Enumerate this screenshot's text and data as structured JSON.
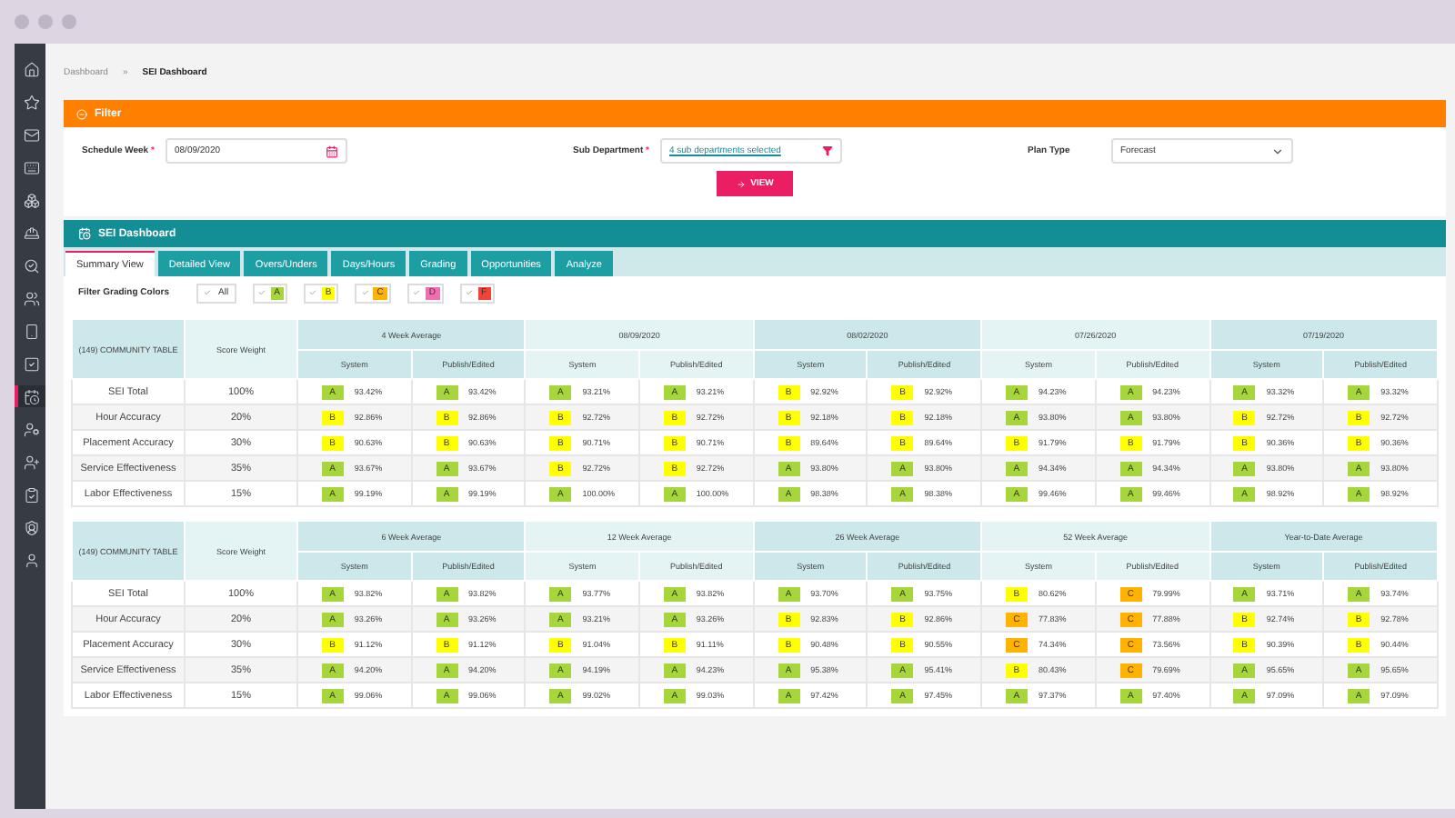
{
  "sidebar": {
    "items": [
      {
        "selected": false
      },
      {
        "selected": false
      },
      {
        "selected": false
      },
      {
        "selected": false
      },
      {
        "selected": false
      },
      {
        "selected": false
      },
      {
        "selected": false
      },
      {
        "selected": false
      },
      {
        "selected": false
      },
      {
        "selected": false
      },
      {
        "selected": true
      },
      {
        "selected": false
      },
      {
        "selected": false
      },
      {
        "selected": false
      },
      {
        "selected": false
      },
      {
        "selected": false
      }
    ]
  },
  "breadcrumb": {
    "items": [
      "Dashboard",
      "SEI Dashboard"
    ],
    "separator": "»"
  },
  "filter": {
    "title": "Filter",
    "schedule_week": {
      "label": "Schedule Week",
      "required_mark": "*",
      "value": "08/09/2020"
    },
    "sub_department": {
      "label": "Sub Department",
      "required_mark": "*",
      "value": "4 sub departments selected"
    },
    "plan_type": {
      "label": "Plan Type",
      "value": "Forecast"
    },
    "button": "VIEW"
  },
  "dashboard": {
    "title": "SEI Dashboard",
    "tabs": [
      {
        "label": "Summary View",
        "selected": true
      },
      {
        "label": "Detailed View",
        "selected": false
      },
      {
        "label": "Overs/Unders",
        "selected": false
      },
      {
        "label": "Days/Hours",
        "selected": false
      },
      {
        "label": "Grading",
        "selected": false
      },
      {
        "label": "Opportunities",
        "selected": false
      },
      {
        "label": "Analyze",
        "selected": false
      }
    ],
    "grading_filter": {
      "label": "Filter Grading Colors",
      "options": [
        {
          "label": "All",
          "checked": true
        },
        {
          "label": "A",
          "checked": true,
          "color": "#a6d53c"
        },
        {
          "label": "B",
          "checked": true,
          "color": "#ffff00"
        },
        {
          "label": "C",
          "checked": true,
          "color": "#ffb300"
        },
        {
          "label": "D",
          "checked": true,
          "color": "#f06fb0"
        },
        {
          "label": "F",
          "checked": true,
          "color": "#f44336"
        }
      ]
    },
    "tables": [
      {
        "title": "(149) COMMUNITY TABLE",
        "weight_header": "Score Weight",
        "groups": [
          {
            "title": "4 Week Average",
            "subheaders": [
              "System",
              "Publish/Edited"
            ]
          },
          {
            "title": "08/09/2020",
            "subheaders": [
              "System",
              "Publish/Edited"
            ]
          },
          {
            "title": "08/02/2020",
            "subheaders": [
              "System",
              "Publish/Edited"
            ]
          },
          {
            "title": "07/26/2020",
            "subheaders": [
              "System",
              "Publish/Edited"
            ]
          },
          {
            "title": "07/19/2020",
            "subheaders": [
              "System",
              "Publish/Edited"
            ]
          }
        ],
        "rows": [
          {
            "name": "SEI Total",
            "weight": "100%",
            "cells": [
              {
                "grade": "A",
                "value": "93.42%",
                "color": "#a6d53c"
              },
              {
                "grade": "A",
                "value": "93.42%",
                "color": "#a6d53c"
              },
              {
                "grade": "A",
                "value": "93.21%",
                "color": "#a6d53c"
              },
              {
                "grade": "A",
                "value": "93.21%",
                "color": "#a6d53c"
              },
              {
                "grade": "B",
                "value": "92.92%",
                "color": "#ffff00"
              },
              {
                "grade": "B",
                "value": "92.92%",
                "color": "#ffff00"
              },
              {
                "grade": "A",
                "value": "94.23%",
                "color": "#a6d53c"
              },
              {
                "grade": "A",
                "value": "94.23%",
                "color": "#a6d53c"
              },
              {
                "grade": "A",
                "value": "93.32%",
                "color": "#a6d53c"
              },
              {
                "grade": "A",
                "value": "93.32%",
                "color": "#a6d53c"
              }
            ]
          },
          {
            "name": "Hour Accuracy",
            "weight": "20%",
            "cells": [
              {
                "grade": "B",
                "value": "92.86%",
                "color": "#ffff00"
              },
              {
                "grade": "B",
                "value": "92.86%",
                "color": "#ffff00"
              },
              {
                "grade": "B",
                "value": "92.72%",
                "color": "#ffff00"
              },
              {
                "grade": "B",
                "value": "92.72%",
                "color": "#ffff00"
              },
              {
                "grade": "B",
                "value": "92.18%",
                "color": "#ffff00"
              },
              {
                "grade": "B",
                "value": "92.18%",
                "color": "#ffff00"
              },
              {
                "grade": "A",
                "value": "93.80%",
                "color": "#a6d53c"
              },
              {
                "grade": "A",
                "value": "93.80%",
                "color": "#a6d53c"
              },
              {
                "grade": "B",
                "value": "92.72%",
                "color": "#ffff00"
              },
              {
                "grade": "B",
                "value": "92.72%",
                "color": "#ffff00"
              }
            ]
          },
          {
            "name": "Placement Accuracy",
            "weight": "30%",
            "cells": [
              {
                "grade": "B",
                "value": "90.63%",
                "color": "#ffff00"
              },
              {
                "grade": "B",
                "value": "90.63%",
                "color": "#ffff00"
              },
              {
                "grade": "B",
                "value": "90.71%",
                "color": "#ffff00"
              },
              {
                "grade": "B",
                "value": "90.71%",
                "color": "#ffff00"
              },
              {
                "grade": "B",
                "value": "89.64%",
                "color": "#ffff00"
              },
              {
                "grade": "B",
                "value": "89.64%",
                "color": "#ffff00"
              },
              {
                "grade": "B",
                "value": "91.79%",
                "color": "#ffff00"
              },
              {
                "grade": "B",
                "value": "91.79%",
                "color": "#ffff00"
              },
              {
                "grade": "B",
                "value": "90.36%",
                "color": "#ffff00"
              },
              {
                "grade": "B",
                "value": "90.36%",
                "color": "#ffff00"
              }
            ]
          },
          {
            "name": "Service Effectiveness",
            "weight": "35%",
            "cells": [
              {
                "grade": "A",
                "value": "93.67%",
                "color": "#a6d53c"
              },
              {
                "grade": "A",
                "value": "93.67%",
                "color": "#a6d53c"
              },
              {
                "grade": "B",
                "value": "92.72%",
                "color": "#ffff00"
              },
              {
                "grade": "B",
                "value": "92.72%",
                "color": "#ffff00"
              },
              {
                "grade": "A",
                "value": "93.80%",
                "color": "#a6d53c"
              },
              {
                "grade": "A",
                "value": "93.80%",
                "color": "#a6d53c"
              },
              {
                "grade": "A",
                "value": "94.34%",
                "color": "#a6d53c"
              },
              {
                "grade": "A",
                "value": "94.34%",
                "color": "#a6d53c"
              },
              {
                "grade": "A",
                "value": "93.80%",
                "color": "#a6d53c"
              },
              {
                "grade": "A",
                "value": "93.80%",
                "color": "#a6d53c"
              }
            ]
          },
          {
            "name": "Labor Effectiveness",
            "weight": "15%",
            "cells": [
              {
                "grade": "A",
                "value": "99.19%",
                "color": "#a6d53c"
              },
              {
                "grade": "A",
                "value": "99.19%",
                "color": "#a6d53c"
              },
              {
                "grade": "A",
                "value": "100.00%",
                "color": "#a6d53c"
              },
              {
                "grade": "A",
                "value": "100.00%",
                "color": "#a6d53c"
              },
              {
                "grade": "A",
                "value": "98.38%",
                "color": "#a6d53c"
              },
              {
                "grade": "A",
                "value": "98.38%",
                "color": "#a6d53c"
              },
              {
                "grade": "A",
                "value": "99.46%",
                "color": "#a6d53c"
              },
              {
                "grade": "A",
                "value": "99.46%",
                "color": "#a6d53c"
              },
              {
                "grade": "A",
                "value": "98.92%",
                "color": "#a6d53c"
              },
              {
                "grade": "A",
                "value": "98.92%",
                "color": "#a6d53c"
              }
            ]
          }
        ]
      },
      {
        "title": "(149) COMMUNITY TABLE",
        "weight_header": "Score Weight",
        "groups": [
          {
            "title": "6 Week Average",
            "subheaders": [
              "System",
              "Publish/Edited"
            ]
          },
          {
            "title": "12 Week Average",
            "subheaders": [
              "System",
              "Publish/Edited"
            ]
          },
          {
            "title": "26 Week Average",
            "subheaders": [
              "System",
              "Publish/Edited"
            ]
          },
          {
            "title": "52 Week Average",
            "subheaders": [
              "System",
              "Publish/Edited"
            ]
          },
          {
            "title": "Year-to-Date Average",
            "subheaders": [
              "System",
              "Publish/Edited"
            ]
          }
        ],
        "rows": [
          {
            "name": "SEI Total",
            "weight": "100%",
            "cells": [
              {
                "grade": "A",
                "value": "93.82%",
                "color": "#a6d53c"
              },
              {
                "grade": "A",
                "value": "93.82%",
                "color": "#a6d53c"
              },
              {
                "grade": "A",
                "value": "93.77%",
                "color": "#a6d53c"
              },
              {
                "grade": "A",
                "value": "93.82%",
                "color": "#a6d53c"
              },
              {
                "grade": "A",
                "value": "93.70%",
                "color": "#a6d53c"
              },
              {
                "grade": "A",
                "value": "93.75%",
                "color": "#a6d53c"
              },
              {
                "grade": "B",
                "value": "80.62%",
                "color": "#ffff00"
              },
              {
                "grade": "C",
                "value": "79.99%",
                "color": "#ffb300"
              },
              {
                "grade": "A",
                "value": "93.71%",
                "color": "#a6d53c"
              },
              {
                "grade": "A",
                "value": "93.74%",
                "color": "#a6d53c"
              }
            ]
          },
          {
            "name": "Hour Accuracy",
            "weight": "20%",
            "cells": [
              {
                "grade": "A",
                "value": "93.26%",
                "color": "#a6d53c"
              },
              {
                "grade": "A",
                "value": "93.26%",
                "color": "#a6d53c"
              },
              {
                "grade": "A",
                "value": "93.21%",
                "color": "#a6d53c"
              },
              {
                "grade": "A",
                "value": "93.26%",
                "color": "#a6d53c"
              },
              {
                "grade": "B",
                "value": "92.83%",
                "color": "#ffff00"
              },
              {
                "grade": "B",
                "value": "92.86%",
                "color": "#ffff00"
              },
              {
                "grade": "C",
                "value": "77.83%",
                "color": "#ffb300"
              },
              {
                "grade": "C",
                "value": "77.88%",
                "color": "#ffb300"
              },
              {
                "grade": "B",
                "value": "92.74%",
                "color": "#ffff00"
              },
              {
                "grade": "B",
                "value": "92.78%",
                "color": "#ffff00"
              }
            ]
          },
          {
            "name": "Placement Accuracy",
            "weight": "30%",
            "cells": [
              {
                "grade": "B",
                "value": "91.12%",
                "color": "#ffff00"
              },
              {
                "grade": "B",
                "value": "91.12%",
                "color": "#ffff00"
              },
              {
                "grade": "B",
                "value": "91.04%",
                "color": "#ffff00"
              },
              {
                "grade": "B",
                "value": "91.11%",
                "color": "#ffff00"
              },
              {
                "grade": "B",
                "value": "90.48%",
                "color": "#ffff00"
              },
              {
                "grade": "B",
                "value": "90.55%",
                "color": "#ffff00"
              },
              {
                "grade": "C",
                "value": "74.34%",
                "color": "#ffb300"
              },
              {
                "grade": "C",
                "value": "73.56%",
                "color": "#ffb300"
              },
              {
                "grade": "B",
                "value": "90.39%",
                "color": "#ffff00"
              },
              {
                "grade": "B",
                "value": "90.44%",
                "color": "#ffff00"
              }
            ]
          },
          {
            "name": "Service Effectiveness",
            "weight": "35%",
            "cells": [
              {
                "grade": "A",
                "value": "94.20%",
                "color": "#a6d53c"
              },
              {
                "grade": "A",
                "value": "94.20%",
                "color": "#a6d53c"
              },
              {
                "grade": "A",
                "value": "94.19%",
                "color": "#a6d53c"
              },
              {
                "grade": "A",
                "value": "94.23%",
                "color": "#a6d53c"
              },
              {
                "grade": "A",
                "value": "95.38%",
                "color": "#a6d53c"
              },
              {
                "grade": "A",
                "value": "95.41%",
                "color": "#a6d53c"
              },
              {
                "grade": "B",
                "value": "80.43%",
                "color": "#ffff00"
              },
              {
                "grade": "C",
                "value": "79.69%",
                "color": "#ffb300"
              },
              {
                "grade": "A",
                "value": "95.65%",
                "color": "#a6d53c"
              },
              {
                "grade": "A",
                "value": "95.65%",
                "color": "#a6d53c"
              }
            ]
          },
          {
            "name": "Labor Effectiveness",
            "weight": "15%",
            "cells": [
              {
                "grade": "A",
                "value": "99.06%",
                "color": "#a6d53c"
              },
              {
                "grade": "A",
                "value": "99.06%",
                "color": "#a6d53c"
              },
              {
                "grade": "A",
                "value": "99.02%",
                "color": "#a6d53c"
              },
              {
                "grade": "A",
                "value": "99.03%",
                "color": "#a6d53c"
              },
              {
                "grade": "A",
                "value": "97.42%",
                "color": "#a6d53c"
              },
              {
                "grade": "A",
                "value": "97.45%",
                "color": "#a6d53c"
              },
              {
                "grade": "A",
                "value": "97.37%",
                "color": "#a6d53c"
              },
              {
                "grade": "A",
                "value": "97.40%",
                "color": "#a6d53c"
              },
              {
                "grade": "A",
                "value": "97.09%",
                "color": "#a6d53c"
              },
              {
                "grade": "A",
                "value": "97.09%",
                "color": "#a6d53c"
              }
            ]
          }
        ]
      }
    ]
  }
}
